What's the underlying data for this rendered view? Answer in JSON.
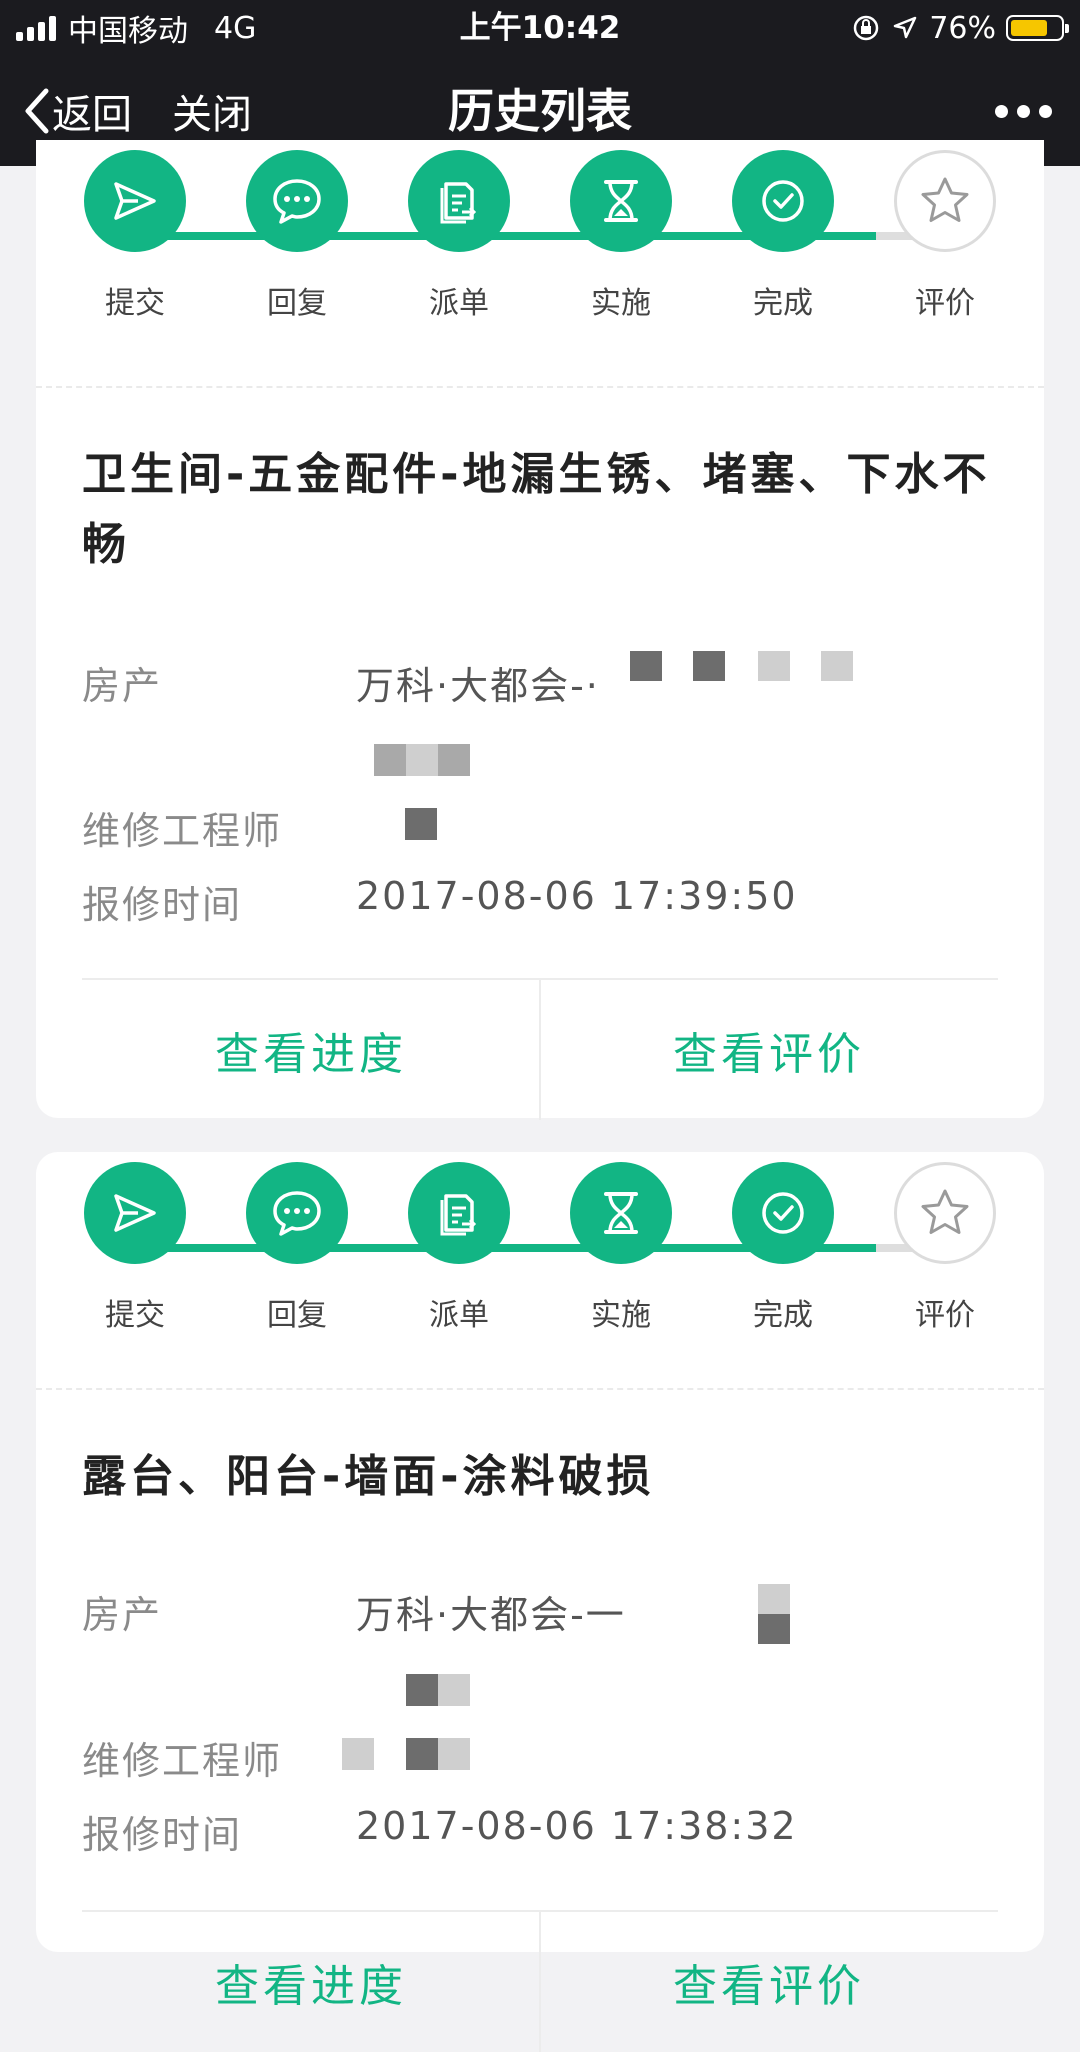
{
  "status_bar": {
    "carrier": "中国移动",
    "network": "4G",
    "time": "上午10:42",
    "battery": "76%",
    "battery_level": 0.76
  },
  "nav": {
    "back_label": "返回",
    "close_label": "关闭",
    "title": "历史列表"
  },
  "colors": {
    "accent": "#12b584",
    "navbar": "#1b1b1f",
    "background": "#f2f2f4"
  },
  "steps": [
    "提交",
    "回复",
    "派单",
    "实施",
    "完成",
    "评价"
  ],
  "step_icons": [
    "send-icon",
    "chat-bubble-icon",
    "document-icon",
    "hourglass-icon",
    "check-circle-icon",
    "star-icon"
  ],
  "completed_steps": 5,
  "cards": [
    {
      "title": "卫生间-五金配件-地漏生锈、堵塞、下水不畅",
      "property_label": "房产",
      "property_value": "万科·大都会-·",
      "engineer_label": "维修工程师",
      "time_label": "报修时间",
      "time_value": "2017-08-06 17:39:50",
      "btn_progress": "查看进度",
      "btn_review": "查看评价"
    },
    {
      "title": "露台、阳台-墙面-涂料破损",
      "property_label": "房产",
      "property_value": "万科·大都会-一",
      "engineer_label": "维修工程师",
      "time_label": "报修时间",
      "time_value": "2017-08-06 17:38:32",
      "btn_progress": "查看进度",
      "btn_review": "查看评价"
    }
  ]
}
